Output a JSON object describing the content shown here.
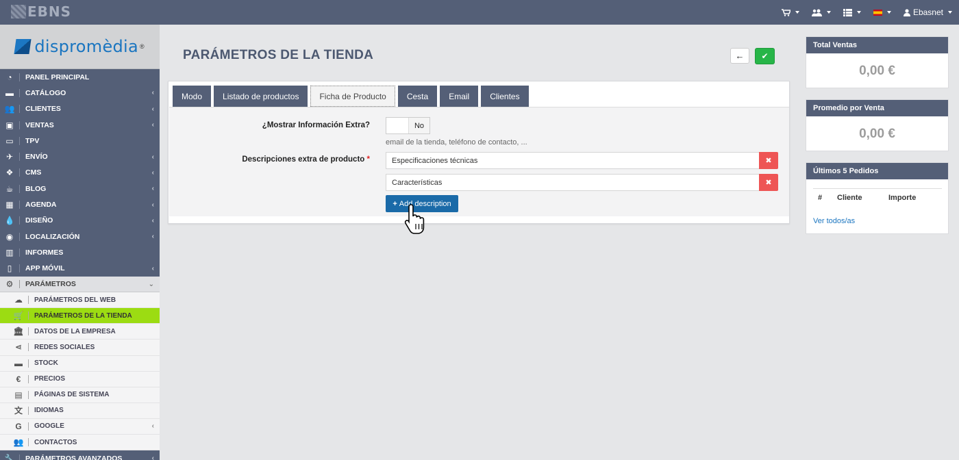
{
  "topbar": {
    "brand": "EBNS",
    "user": "Ebasnet"
  },
  "sidebar": {
    "logo": "dispromèdia",
    "items": [
      {
        "label": "PANEL PRINCIPAL",
        "icon": "dashboard-icon",
        "chev": false
      },
      {
        "label": "CATÁLOGO",
        "icon": "book-icon",
        "chev": true
      },
      {
        "label": "CLIENTES",
        "icon": "users-icon",
        "chev": true
      },
      {
        "label": "VENTAS",
        "icon": "money-icon",
        "chev": true
      },
      {
        "label": "TPV",
        "icon": "card-icon",
        "chev": false
      },
      {
        "label": "ENVÍO",
        "icon": "paper-plane-icon",
        "chev": true
      },
      {
        "label": "CMS",
        "icon": "cubes-icon",
        "chev": true
      },
      {
        "label": "BLOG",
        "icon": "cup-icon",
        "chev": true
      },
      {
        "label": "AGENDA",
        "icon": "calendar-icon",
        "chev": true
      },
      {
        "label": "DISEÑO",
        "icon": "tint-icon",
        "chev": true
      },
      {
        "label": "LOCALIZACIÓN",
        "icon": "globe-icon",
        "chev": true
      },
      {
        "label": "INFORMES",
        "icon": "bar-chart-icon",
        "chev": false
      },
      {
        "label": "APP MÓVIL",
        "icon": "mobile-icon",
        "chev": true
      }
    ],
    "open_section": "PARÁMETROS",
    "subitems": [
      {
        "label": "PARÁMETROS DEL WEB",
        "icon": "cloud-icon",
        "chev": false
      },
      {
        "label": "PARÁMETROS DE LA TIENDA",
        "icon": "cart-icon",
        "chev": false
      },
      {
        "label": "DATOS DE LA EMPRESA",
        "icon": "bank-icon",
        "chev": false
      },
      {
        "label": "REDES SOCIALES",
        "icon": "share-icon",
        "chev": false
      },
      {
        "label": "STOCK",
        "icon": "book-icon",
        "chev": false
      },
      {
        "label": "PRECIOS",
        "icon": "euro-icon",
        "chev": false
      },
      {
        "label": "PÁGINAS DE SISTEMA",
        "icon": "file-icon",
        "chev": false
      },
      {
        "label": "IDIOMAS",
        "icon": "language-icon",
        "chev": false
      },
      {
        "label": "GOOGLE",
        "icon": "google-icon",
        "chev": true
      },
      {
        "label": "CONTACTOS",
        "icon": "users-icon",
        "chev": false
      }
    ],
    "last_item": "PARÁMETROS AVANZADOS"
  },
  "main": {
    "title": "PARÁMETROS DE LA TIENDA",
    "tabs": [
      "Modo",
      "Listado de productos",
      "Ficha de Producto",
      "Cesta",
      "Email",
      "Clientes"
    ],
    "active_tab": "Ficha de Producto",
    "extra_info_label": "¿Mostrar Información Extra?",
    "extra_info_value": "No",
    "extra_info_help": "email de la tienda, teléfono de contacto, ...",
    "descriptions_label": "Descripciones extra de producto",
    "descriptions": [
      "Especificaciones técnicas",
      "Características"
    ],
    "add_label": "Add description"
  },
  "widgets": {
    "total_ventas": {
      "title": "Total Ventas",
      "value": "0,00 €"
    },
    "promedio": {
      "title": "Promedio por Venta",
      "value": "0,00 €"
    },
    "pedidos": {
      "title": "Últimos 5 Pedidos",
      "col_hash": "#",
      "col_cliente": "Cliente",
      "col_importe": "Importe",
      "link": "Ver todos/as"
    }
  }
}
